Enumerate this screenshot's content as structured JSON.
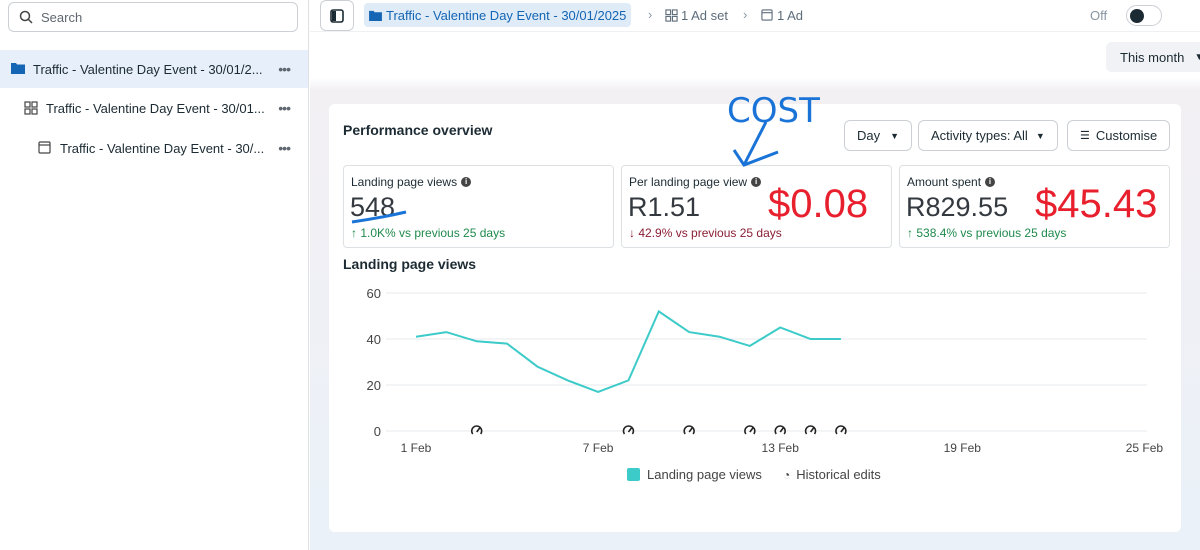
{
  "sidebar": {
    "search_placeholder": "Search",
    "items": [
      {
        "label": "Traffic - Valentine Day Event - 30/01/2..."
      },
      {
        "label": "Traffic - Valentine Day Event - 30/01..."
      },
      {
        "label": "Traffic - Valentine Day Event - 30/..."
      }
    ]
  },
  "topbar": {
    "campaign": "Traffic - Valentine Day Event - 30/01/2025",
    "adset": "1 Ad set",
    "ad": "1 Ad",
    "status": "Off"
  },
  "date_range": "This month",
  "overview": {
    "title": "Performance overview",
    "day_button": "Day",
    "activity_button": "Activity types: All",
    "customise_button": "Customise",
    "metrics": [
      {
        "label": "Landing page views",
        "value": "548",
        "change": "1.0K% vs previous 25 days",
        "direction": "up"
      },
      {
        "label": "Per landing page view",
        "value": "R1.51",
        "usd": "$0.08",
        "change": "42.9% vs previous 25 days",
        "direction": "down"
      },
      {
        "label": "Amount spent",
        "value": "R829.55",
        "usd": "$45.43",
        "change": "538.4% vs previous 25 days",
        "direction": "up"
      }
    ],
    "annotation": "COST"
  },
  "chart_data": {
    "type": "line",
    "title": "Landing page views",
    "x": [
      "1 Feb",
      "2 Feb",
      "3 Feb",
      "4 Feb",
      "5 Feb",
      "6 Feb",
      "7 Feb",
      "8 Feb",
      "9 Feb",
      "10 Feb",
      "11 Feb",
      "12 Feb",
      "13 Feb",
      "14 Feb",
      "15 Feb"
    ],
    "series": [
      {
        "name": "Landing page views",
        "color": "#3ccbc8",
        "values": [
          41,
          43,
          39,
          38,
          28,
          22,
          17,
          22,
          52,
          43,
          41,
          37,
          45,
          40,
          40
        ]
      }
    ],
    "historical_edit_days": [
      3,
      8,
      10,
      12,
      13,
      14,
      15
    ],
    "x_ticks": [
      "1 Feb",
      "7 Feb",
      "13 Feb",
      "19 Feb",
      "25 Feb"
    ],
    "x_tick_days": [
      1,
      7,
      13,
      19,
      25
    ],
    "y_ticks": [
      0,
      20,
      40,
      60
    ],
    "ylim": [
      0,
      60
    ],
    "legend": [
      "Landing page views",
      "Historical edits"
    ],
    "legend_position": "bottom"
  }
}
